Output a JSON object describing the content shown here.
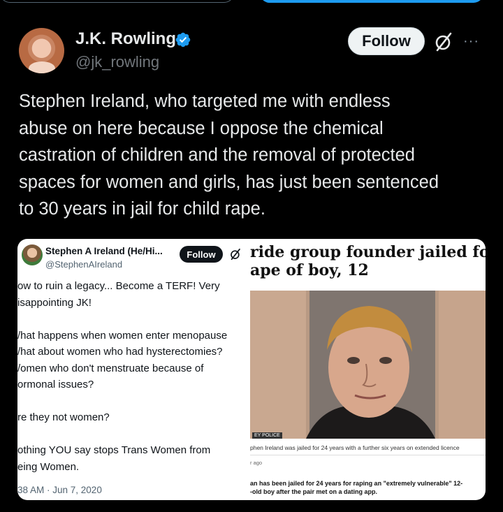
{
  "author": {
    "name": "J.K. Rowling",
    "handle": "@jk_rowling",
    "follow_label": "Follow",
    "more_label": "···"
  },
  "tweet": {
    "lines": [
      "Stephen Ireland, who targeted me with endless",
      "abuse on here because I oppose the chemical",
      "castration of children and the removal of protected",
      "spaces for women and girls, has just been sentenced",
      "to 30 years in jail for child rape."
    ]
  },
  "embedded_tweet": {
    "name": "Stephen A Ireland (He/Hi...",
    "handle": "@StephenAIreland",
    "follow_label": "Follow",
    "lines": [
      "ow to ruin a legacy... Become a TERF! Very",
      "isappointing JK!",
      "",
      "/hat happens when women enter menopause",
      "/hat about women who had hysterectomies?",
      "/omen who don't menstruate because of",
      "ormonal issues?",
      "",
      "re they not women?",
      "",
      "othing YOU say stops Trans Women from",
      "eing Women."
    ],
    "timestamp": "38 AM · Jun 7, 2020"
  },
  "news_article": {
    "headline_line1": "ride group founder jailed fo",
    "headline_line2": "ape of boy, 12",
    "photo_credit": "EY POLICE",
    "caption": "phen Ireland was jailed for 24 years with a further six years on extended licence",
    "time_ago": "r ago",
    "body_line1": "an has been jailed for 24 years for raping an \"extremely vulnerable\" 12-",
    "body_line2": "-old boy after the pair met on a dating app."
  },
  "colors": {
    "background": "#000000",
    "text": "#e7e9ea",
    "muted": "#71767b",
    "verified": "#1d9bf0",
    "follow_bg": "#eff3f4"
  },
  "icons": {
    "verified": "verified-badge-icon",
    "grok": "grok-icon",
    "more": "more-icon"
  }
}
